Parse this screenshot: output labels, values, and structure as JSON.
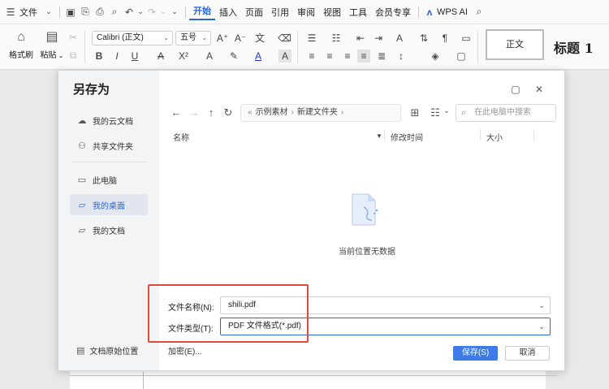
{
  "menubar": {
    "file_label": "文件",
    "tabs": [
      "开始",
      "插入",
      "页面",
      "引用",
      "审阅",
      "视图",
      "工具",
      "会员专享"
    ],
    "active_tab": "开始",
    "wps_ai_label": "WPS AI"
  },
  "toolbar": {
    "format_painter_label": "格式刷",
    "paste_label": "粘贴",
    "font_name": "Calibri (正文)",
    "font_size": "五号",
    "style_normal": "正文",
    "style_heading": "标题 1"
  },
  "dialog": {
    "title": "另存为",
    "sidebar": {
      "items": [
        {
          "label": "我的云文档",
          "icon": "cloud-icon"
        },
        {
          "label": "共享文件夹",
          "icon": "share-icon"
        },
        {
          "label": "此电脑",
          "icon": "monitor-icon"
        },
        {
          "label": "我的桌面",
          "icon": "folder-icon"
        },
        {
          "label": "我的文档",
          "icon": "folder-icon"
        }
      ],
      "selected": "我的桌面",
      "original_location_label": "文档原始位置"
    },
    "path": {
      "crumbs": [
        "示例素材",
        "新建文件夹"
      ]
    },
    "search_placeholder": "在此电脑中搜索",
    "columns": {
      "name": "名称",
      "modified": "修改时间",
      "size": "大小"
    },
    "empty_message": "当前位置无数据",
    "filename_label": "文件名称(N):",
    "filename_value": "shili.pdf",
    "filetype_label": "文件类型(T):",
    "filetype_value": "PDF 文件格式(*.pdf)",
    "encrypt_label": "加密(E)...",
    "save_label": "保存(S)",
    "cancel_label": "取消",
    "highlight_color": "#e04a3a",
    "accent_color": "#3d7ce6"
  }
}
